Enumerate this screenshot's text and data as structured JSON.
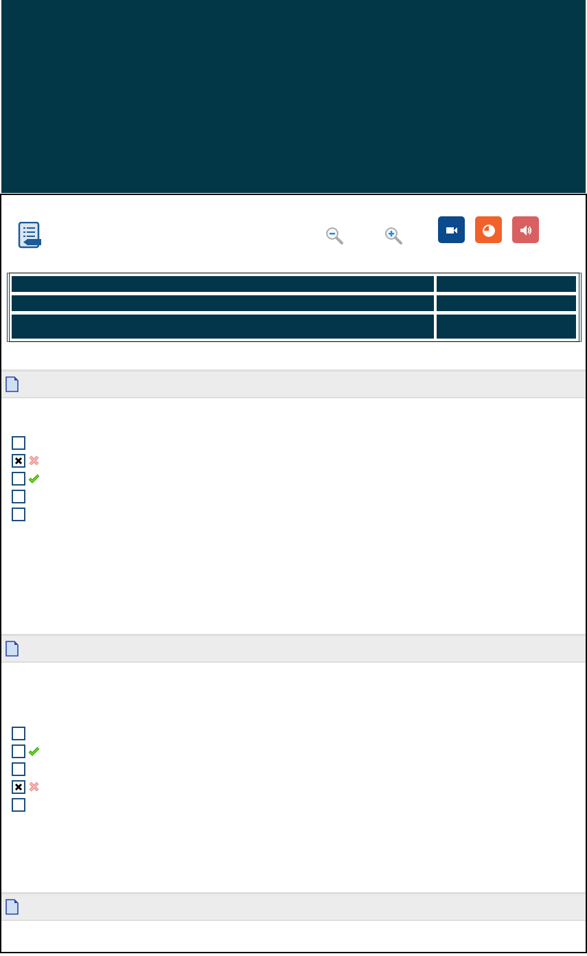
{
  "toolbar": {
    "zoom_buttons": [
      {
        "kind": "zoom-out"
      },
      {
        "kind": "zoom-in"
      }
    ],
    "media_buttons": [
      {
        "kind": "video",
        "color": "#0b4a8c"
      },
      {
        "kind": "chart",
        "color": "#f0622a"
      },
      {
        "kind": "audio",
        "color": "#d96060"
      }
    ]
  },
  "info_table": {
    "rows": [
      {
        "kind": "single"
      },
      {
        "kind": "single"
      },
      {
        "kind": "double"
      }
    ]
  },
  "questions": [
    {
      "kind": "question",
      "options": [
        {
          "checked": false,
          "kind": "plain"
        },
        {
          "checked": true,
          "kind": "wrong"
        },
        {
          "checked": false,
          "kind": "correct"
        },
        {
          "checked": false,
          "kind": "plain"
        },
        {
          "checked": false,
          "kind": "plain"
        }
      ]
    },
    {
      "kind": "question",
      "options": [
        {
          "checked": false,
          "kind": "plain"
        },
        {
          "checked": false,
          "kind": "correct"
        },
        {
          "checked": false,
          "kind": "plain"
        },
        {
          "checked": true,
          "kind": "wrong"
        },
        {
          "checked": false,
          "kind": "plain"
        }
      ]
    },
    {
      "kind": "question"
    }
  ]
}
